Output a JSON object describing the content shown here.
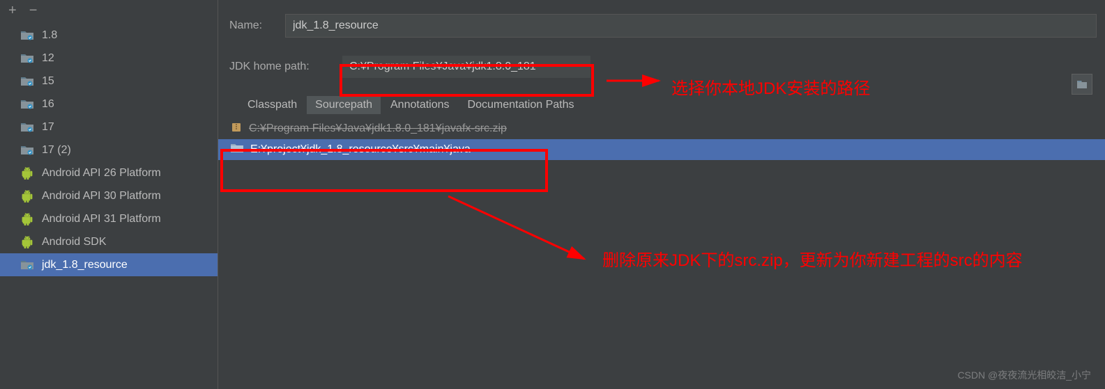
{
  "toolbar": {
    "add": "+",
    "remove": "−"
  },
  "tree": [
    {
      "label": "1.8",
      "type": "folder"
    },
    {
      "label": "12",
      "type": "folder"
    },
    {
      "label": "15",
      "type": "folder"
    },
    {
      "label": "16",
      "type": "folder"
    },
    {
      "label": "17",
      "type": "folder"
    },
    {
      "label": "17 (2)",
      "type": "folder"
    },
    {
      "label": "Android API 26 Platform",
      "type": "android"
    },
    {
      "label": "Android API 30 Platform",
      "type": "android"
    },
    {
      "label": "Android API 31 Platform",
      "type": "android"
    },
    {
      "label": "Android SDK",
      "type": "android"
    },
    {
      "label": "jdk_1.8_resource",
      "type": "folder",
      "selected": true
    }
  ],
  "form": {
    "nameLabel": "Name:",
    "nameValue": "jdk_1.8_resource",
    "jdkLabel": "JDK home path:",
    "jdkPath": "C:¥Program Files¥Java¥jdk1.8.0_181"
  },
  "tabs": [
    "Classpath",
    "Sourcepath",
    "Annotations",
    "Documentation Paths"
  ],
  "activeTab": 1,
  "paths": [
    {
      "text": "C:¥Program Files¥Java¥jdk1.8.0_181¥javafx-src.zip",
      "type": "zip",
      "struck": true
    },
    {
      "text": "E:¥project¥jdk_1.8_resource¥src¥main¥java",
      "type": "dir",
      "selected": true
    }
  ],
  "annotations": {
    "a1": "选择你本地JDK安装的路径",
    "a2": "删除原来JDK下的src.zip，更新为你新建工程的src的内容"
  },
  "colors": {
    "accent": "#4b6eaf",
    "bg": "#3c3f41",
    "red": "#ff0000"
  },
  "watermark": "CSDN @夜夜流光相皎洁_小宁"
}
